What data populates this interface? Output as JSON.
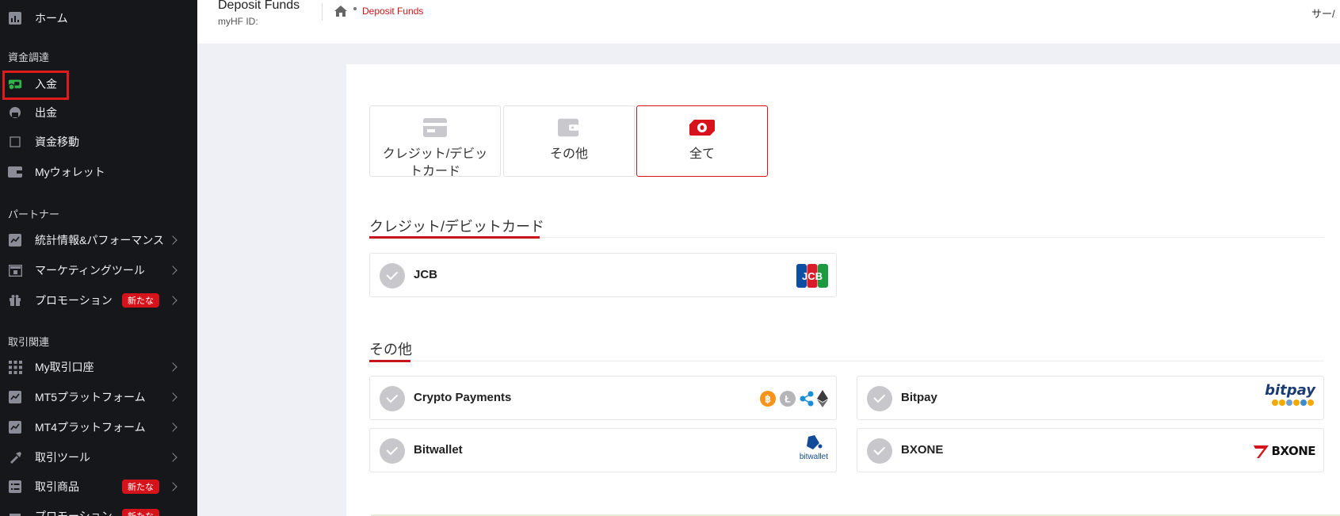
{
  "sidebar": {
    "items": [
      {
        "label": "ホーム",
        "icon": "chart-bar-icon"
      },
      {
        "label": "入金",
        "icon": "deposit-icon"
      },
      {
        "label": "出金",
        "icon": "withdraw-icon"
      },
      {
        "label": "資金移動",
        "icon": "transfer-icon"
      },
      {
        "label": "Myウォレット",
        "icon": "wallet-icon"
      },
      {
        "label": "統計情報&パフォーマンス",
        "icon": "stats-icon"
      },
      {
        "label": "マーケティングツール",
        "icon": "marketing-icon"
      },
      {
        "label": "プロモーション",
        "icon": "gift-icon",
        "badge": "新たな"
      },
      {
        "label": "My取引口座",
        "icon": "grid-icon"
      },
      {
        "label": "MT5プラットフォーム",
        "icon": "mt5-icon"
      },
      {
        "label": "MT4プラットフォーム",
        "icon": "mt4-icon"
      },
      {
        "label": "取引ツール",
        "icon": "tools-icon"
      },
      {
        "label": "取引商品",
        "icon": "list-icon",
        "badge": "新たな"
      },
      {
        "label": "プロモーション",
        "icon": "gift-icon",
        "badge": "新たな"
      }
    ],
    "sections": {
      "funding": "資金調達",
      "partner": "パートナー",
      "trading": "取引関連"
    }
  },
  "header": {
    "title": "Deposit Funds",
    "myhf_label": "myHF ID:",
    "breadcrumb_current": "Deposit Funds",
    "server_label": "サー/"
  },
  "tabs": [
    {
      "label": "クレジット/デビットカード",
      "icon": "credit-card-icon",
      "active": false
    },
    {
      "label": "その他",
      "icon": "wallet-icon",
      "active": false
    },
    {
      "label": "全て",
      "icon": "banknote-icon",
      "active": true
    }
  ],
  "sections": {
    "card": {
      "title": "クレジット/デビットカード",
      "methods": [
        {
          "label": "JCB",
          "logo": "jcb-logo"
        }
      ]
    },
    "other": {
      "title": "その他",
      "methods": [
        {
          "label": "Crypto Payments",
          "logo": "crypto-logos"
        },
        {
          "label": "Bitpay",
          "logo": "bitpay-logo"
        },
        {
          "label": "Bitwallet",
          "logo": "bitwallet-logo"
        },
        {
          "label": "BXONE",
          "logo": "bxone-logo"
        }
      ]
    }
  },
  "logos": {
    "jcb": "JCB",
    "bitpay": "bitpay",
    "bitwallet": "bitwallet",
    "bxone": "BXONE"
  },
  "colors": {
    "accent": "#c8151d",
    "sidebar_bg": "#16171b",
    "badge": "#d6121a",
    "deposit_icon": "#2fb34a"
  }
}
